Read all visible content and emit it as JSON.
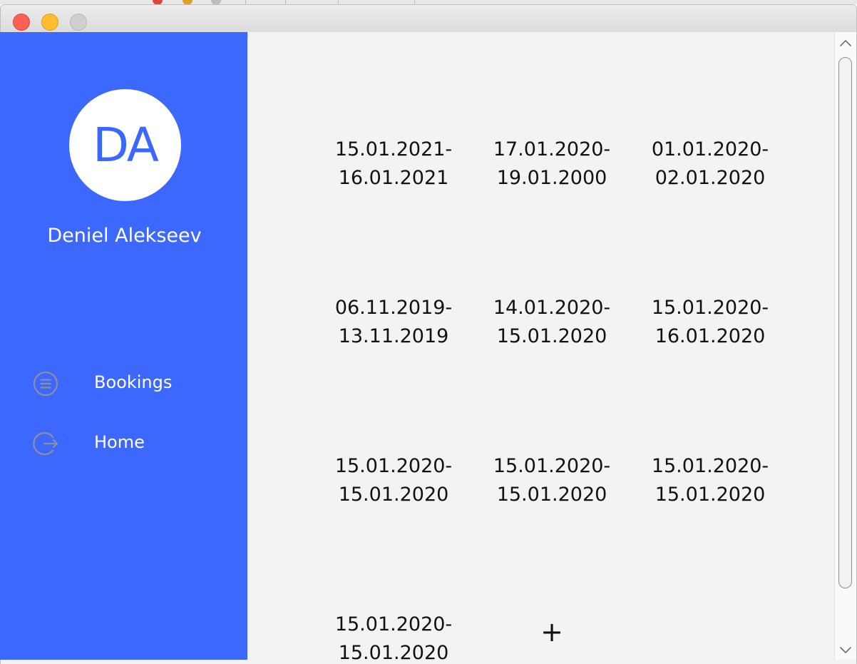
{
  "window": {
    "controls": {
      "close": "close-button",
      "minimize": "minimize-button",
      "zoom": "zoom-button"
    }
  },
  "sidebar": {
    "avatar_initials": "DA",
    "user_name": "Deniel Alekseev",
    "nav": [
      {
        "label": "Bookings",
        "icon": "list-circle-icon"
      },
      {
        "label": "Home",
        "icon": "logout-icon"
      }
    ]
  },
  "bookings": [
    {
      "start": "15.01.2021-",
      "end": "16.01.2021"
    },
    {
      "start": "17.01.2020-",
      "end": "19.01.2000"
    },
    {
      "start": "01.01.2020-",
      "end": "02.01.2020"
    },
    {
      "start": "06.11.2019-",
      "end": "13.11.2019"
    },
    {
      "start": "14.01.2020-",
      "end": "15.01.2020"
    },
    {
      "start": "15.01.2020-",
      "end": "16.01.2020"
    },
    {
      "start": "15.01.2020-",
      "end": "15.01.2020"
    },
    {
      "start": "15.01.2020-",
      "end": "15.01.2020"
    },
    {
      "start": "15.01.2020-",
      "end": "15.01.2020"
    },
    {
      "start": "15.01.2020-",
      "end": "15.01.2020"
    }
  ],
  "add_button": {
    "label": "+"
  },
  "colors": {
    "sidebar_bg": "#3c68fd",
    "content_bg": "#f3f3f3",
    "avatar_bg": "#ffffff",
    "avatar_text": "#3c68fd",
    "nav_icon": "#8a8fa3"
  }
}
